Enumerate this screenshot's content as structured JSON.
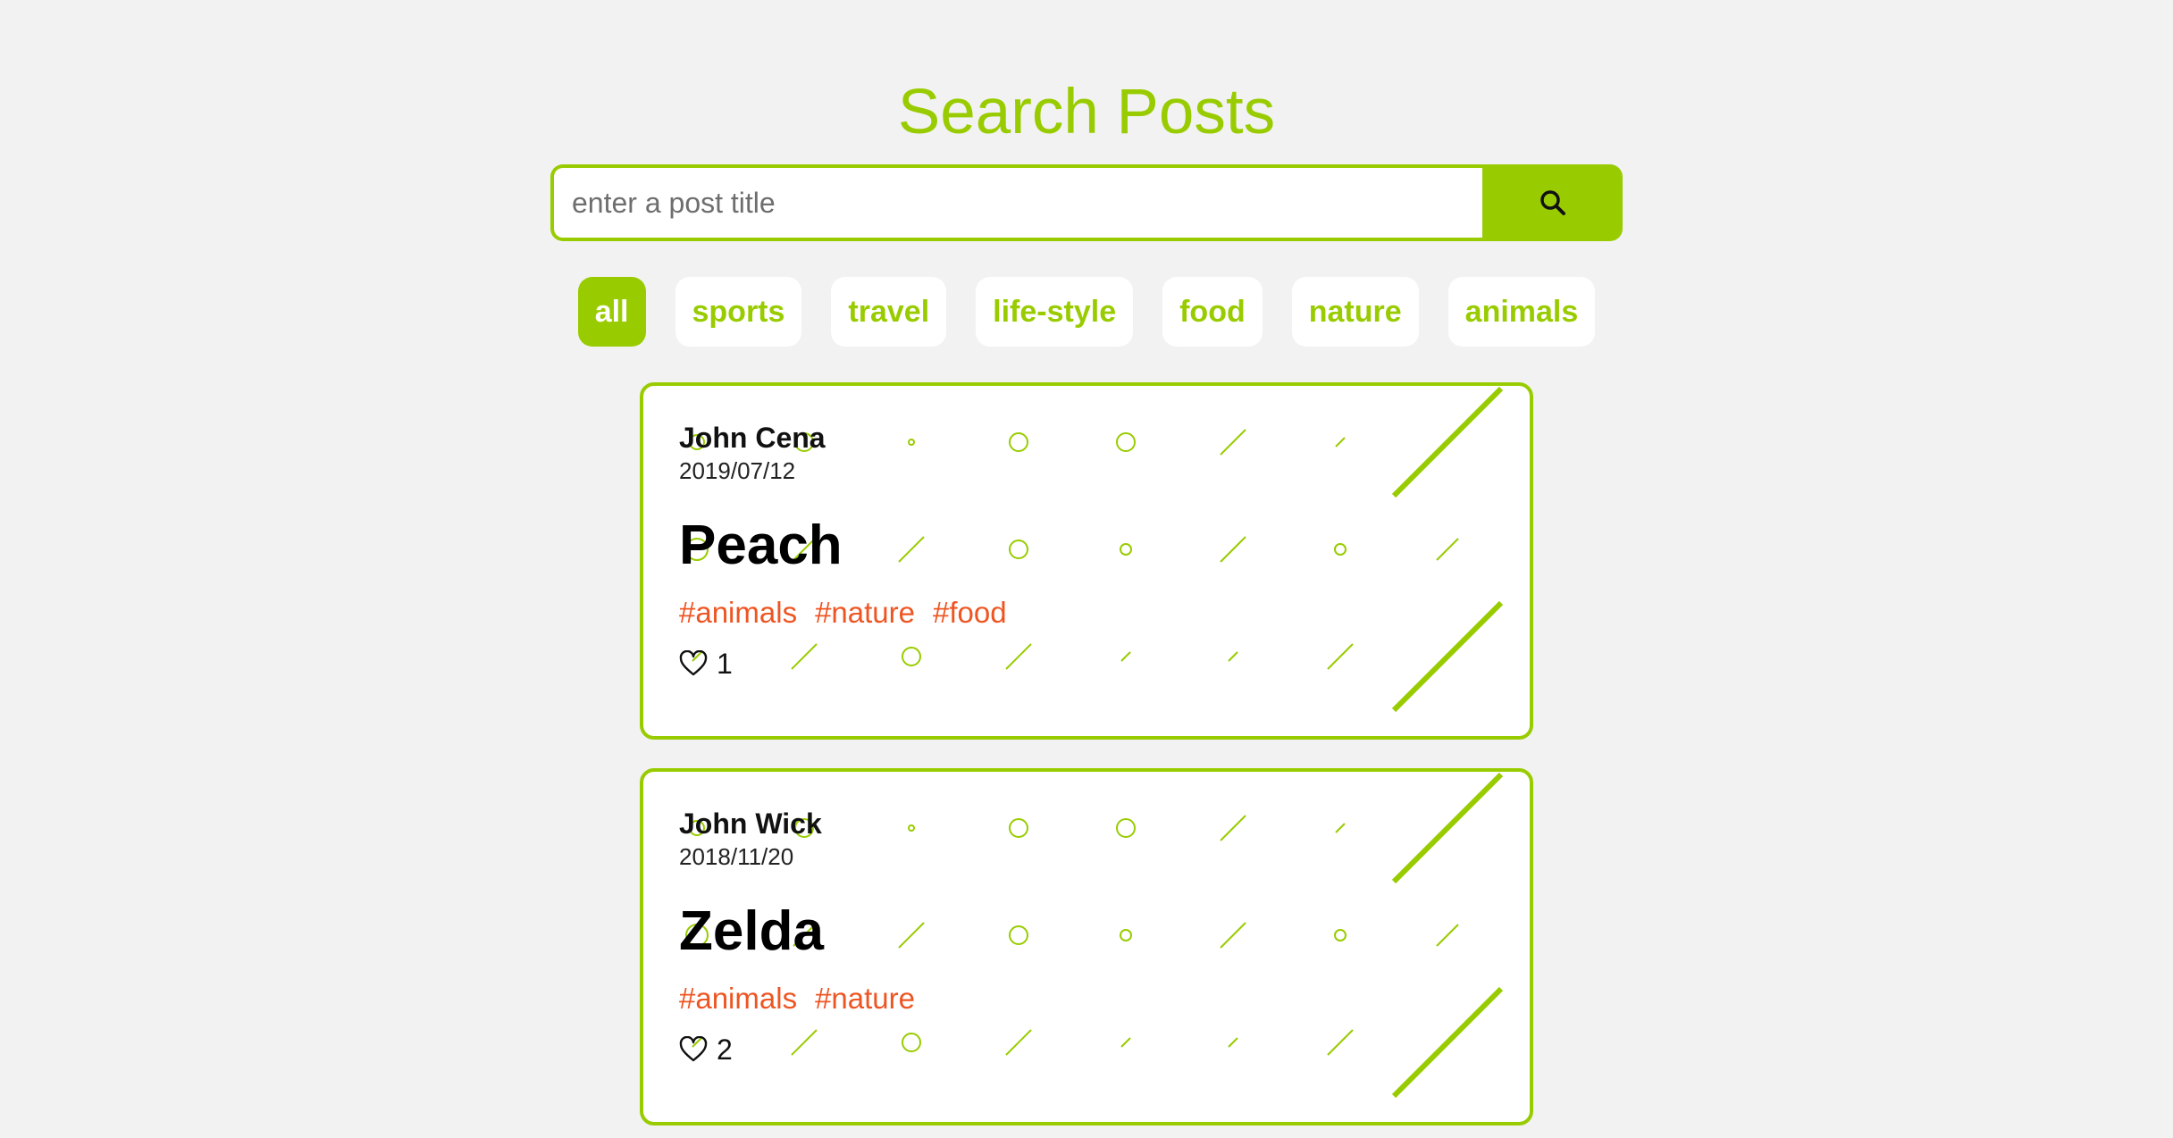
{
  "page": {
    "title": "Search Posts"
  },
  "search": {
    "placeholder": "enter a post title",
    "value": "",
    "button_icon": "search-icon"
  },
  "filters": [
    {
      "label": "all",
      "active": true
    },
    {
      "label": "sports",
      "active": false
    },
    {
      "label": "travel",
      "active": false
    },
    {
      "label": "life-style",
      "active": false
    },
    {
      "label": "food",
      "active": false
    },
    {
      "label": "nature",
      "active": false
    },
    {
      "label": "animals",
      "active": false
    }
  ],
  "posts": [
    {
      "author": "John Cena",
      "date": "2019/07/12",
      "title": "Peach",
      "tags": [
        "#animals",
        "#nature",
        "#food"
      ],
      "likes": "1"
    },
    {
      "author": "John Wick",
      "date": "2018/11/20",
      "title": "Zelda",
      "tags": [
        "#animals",
        "#nature"
      ],
      "likes": "2"
    }
  ],
  "colors": {
    "accent": "#99cc00",
    "tag": "#ee5522",
    "background": "#f2f2f2"
  }
}
